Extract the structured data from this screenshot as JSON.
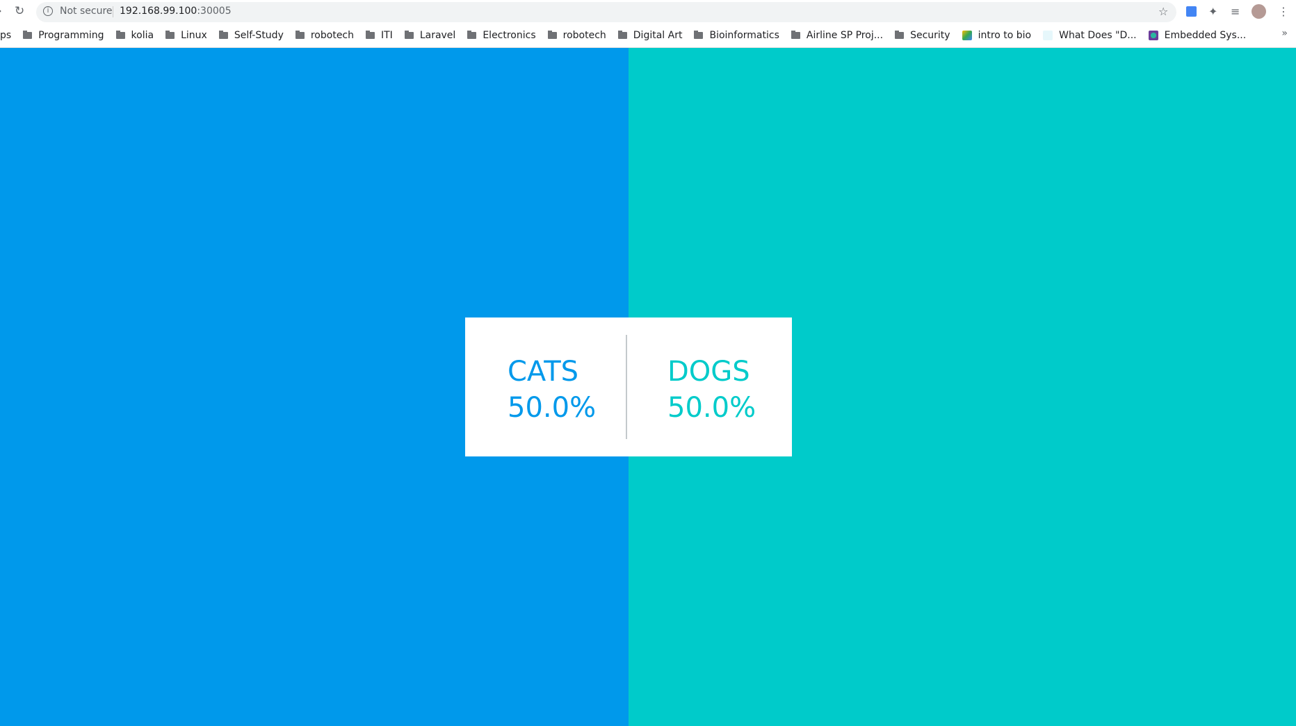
{
  "browser": {
    "security_label": "Not secure",
    "url_host": "192.168.99.100",
    "url_port": ":30005",
    "bookmarks": [
      {
        "label": "ps",
        "icon": "apps"
      },
      {
        "label": "Programming",
        "icon": "folder"
      },
      {
        "label": "kolia",
        "icon": "folder"
      },
      {
        "label": "Linux",
        "icon": "folder"
      },
      {
        "label": "Self-Study",
        "icon": "folder"
      },
      {
        "label": "robotech",
        "icon": "folder"
      },
      {
        "label": "ITI",
        "icon": "folder"
      },
      {
        "label": "Laravel",
        "icon": "folder"
      },
      {
        "label": "Electronics",
        "icon": "folder"
      },
      {
        "label": "robotech",
        "icon": "folder"
      },
      {
        "label": "Digital Art",
        "icon": "folder"
      },
      {
        "label": "Bioinformatics",
        "icon": "folder"
      },
      {
        "label": "Airline SP Proj...",
        "icon": "folder"
      },
      {
        "label": "Security",
        "icon": "folder"
      },
      {
        "label": "intro to bio",
        "icon": "google-drive"
      },
      {
        "label": "What Does \"D...",
        "icon": "m-site"
      },
      {
        "label": "Embedded Sys...",
        "icon": "dots-app"
      }
    ],
    "more_label": "»"
  },
  "result": {
    "options": [
      {
        "name": "CATS",
        "percent": "50.0%",
        "color": "#0099eb"
      },
      {
        "name": "DOGS",
        "percent": "50.0%",
        "color": "#00cbca"
      }
    ]
  }
}
